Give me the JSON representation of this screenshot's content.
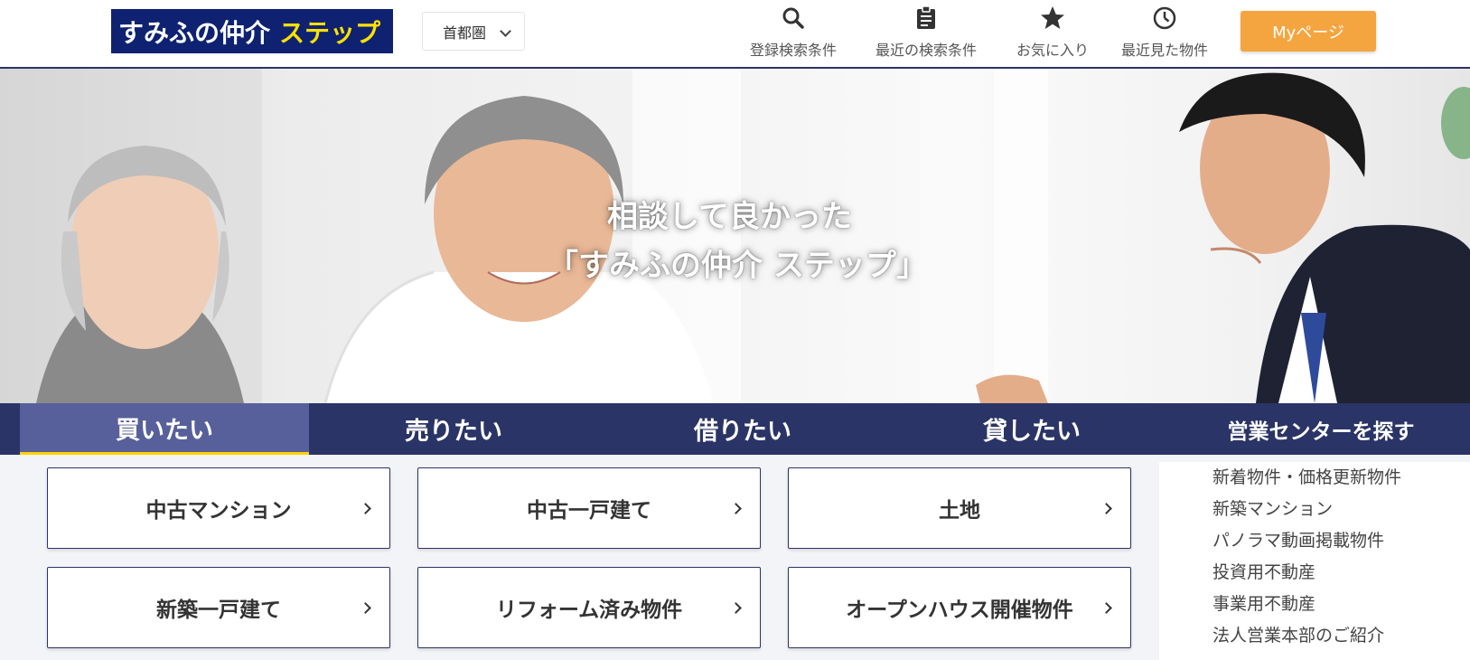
{
  "header": {
    "logo_main": "すみふの仲介",
    "logo_accent": "ステップ",
    "region_select": "首都圏",
    "nav": [
      {
        "label": "登録検索条件",
        "icon": "search-icon"
      },
      {
        "label": "最近の検索条件",
        "icon": "clipboard-icon"
      },
      {
        "label": "お気に入り",
        "icon": "star-icon"
      },
      {
        "label": "最近見た物件",
        "icon": "clock-icon"
      }
    ],
    "my_page": "Myページ"
  },
  "hero": {
    "line1": "相談して良かった",
    "line2": "「すみふの仲介 ステップ」"
  },
  "tabs": [
    {
      "label": "買いたい",
      "active": true
    },
    {
      "label": "売りたい",
      "active": false
    },
    {
      "label": "借りたい",
      "active": false
    },
    {
      "label": "貸したい",
      "active": false
    },
    {
      "label": "営業センターを探す",
      "active": false
    }
  ],
  "categories": [
    "中古マンション",
    "中古一戸建て",
    "土地",
    "新築一戸建て",
    "リフォーム済み物件",
    "オープンハウス開催物件"
  ],
  "side_links": [
    "新着物件・価格更新物件",
    "新築マンション",
    "パノラマ動画掲載物件",
    "投資用不動産",
    "事業用不動産",
    "法人営業本部のご紹介"
  ],
  "colors": {
    "navy": "#2b3466",
    "logo_bg": "#0f2272",
    "logo_accent": "#ffe100",
    "my_button": "#f5a540",
    "active_tab": "#57609a",
    "active_underline": "#ffd400"
  }
}
